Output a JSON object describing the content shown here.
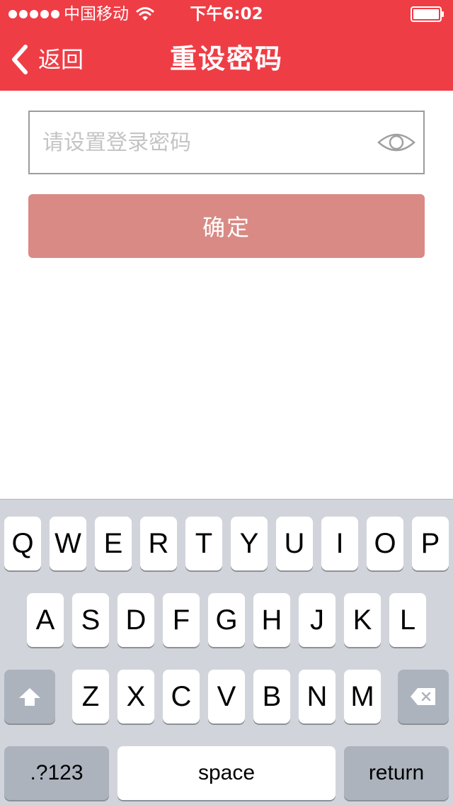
{
  "status_bar": {
    "carrier": "中国移动",
    "time": "下午6:02",
    "icons": [
      "signal-dots-icon",
      "wifi-icon",
      "battery-icon"
    ]
  },
  "header": {
    "back_label": "返回",
    "title": "重设密码",
    "background_color": "#ef3d46"
  },
  "form": {
    "password_placeholder": "请设置登录密码",
    "password_value": "",
    "toggle_icon": "eye-icon",
    "confirm_label": "确定",
    "confirm_color": "#d98a84"
  },
  "keyboard": {
    "row1": [
      "Q",
      "W",
      "E",
      "R",
      "T",
      "Y",
      "U",
      "I",
      "O",
      "P"
    ],
    "row2": [
      "A",
      "S",
      "D",
      "F",
      "G",
      "H",
      "J",
      "K",
      "L"
    ],
    "row3": [
      "Z",
      "X",
      "C",
      "V",
      "B",
      "N",
      "M"
    ],
    "shift_icon": "shift-icon",
    "delete_icon": "delete-icon",
    "numbers_label": ".?123",
    "space_label": "space",
    "return_label": "return"
  }
}
